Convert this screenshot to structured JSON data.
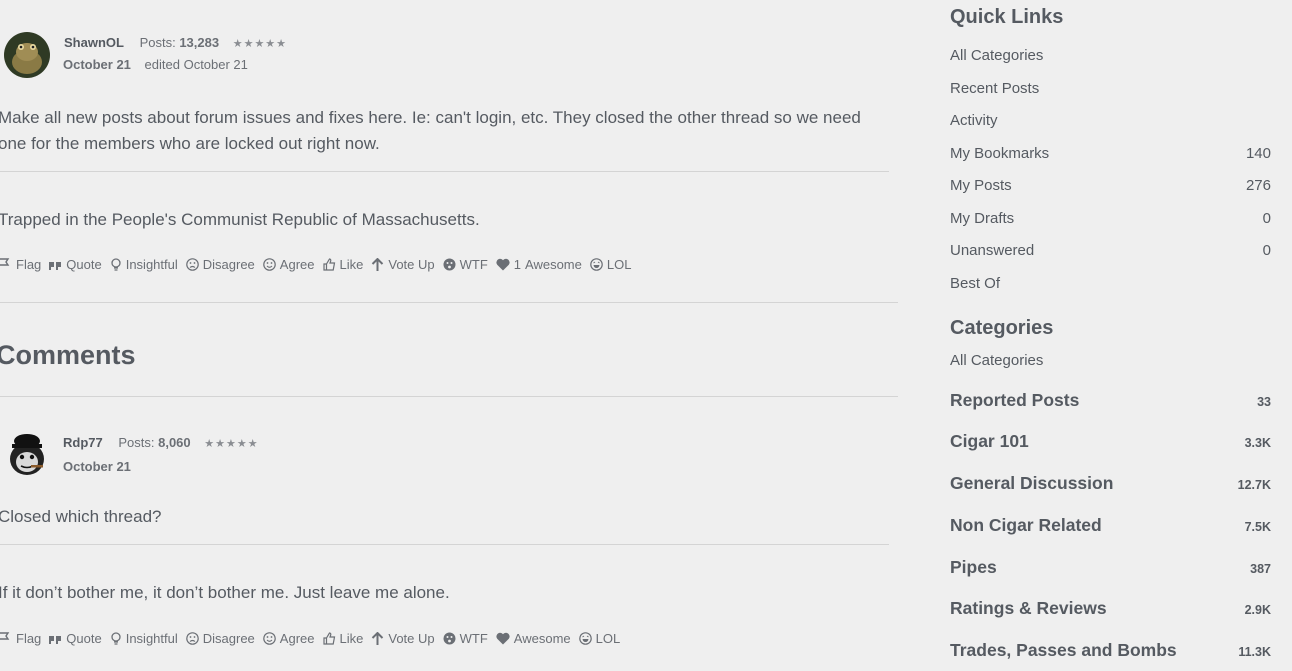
{
  "post": {
    "author": "ShawnOL",
    "posts_label": "Posts:",
    "posts_count": "13,283",
    "stars": "★★★★★",
    "date": "October 21",
    "edited": "edited October 21",
    "body": "Make all new posts about forum issues and fixes here. Ie: can't login, etc. They closed the other thread so we need one for the members who are locked out right now.",
    "signature": "Trapped in the People's Communist Republic of Massachusetts.",
    "reactions": {
      "flag": "Flag",
      "quote": "Quote",
      "insightful": "Insightful",
      "disagree": "Disagree",
      "agree": "Agree",
      "like": "Like",
      "vote_up": "Vote Up",
      "wtf": "WTF",
      "awesome_count": "1",
      "awesome": "Awesome",
      "lol": "LOL"
    }
  },
  "comments_title": "Comments",
  "comment": {
    "author": "Rdp77",
    "posts_label": "Posts:",
    "posts_count": "8,060",
    "stars": "★★★★★",
    "date": "October 21",
    "body": "Closed which thread?",
    "signature": "If it don’t bother me, it don’t bother me. Just leave me alone.",
    "reactions": {
      "flag": "Flag",
      "quote": "Quote",
      "insightful": "Insightful",
      "disagree": "Disagree",
      "agree": "Agree",
      "like": "Like",
      "vote_up": "Vote Up",
      "wtf": "WTF",
      "awesome": "Awesome",
      "lol": "LOL"
    }
  },
  "sidebar": {
    "quick_links_title": "Quick Links",
    "quick_links": [
      {
        "label": "All Categories",
        "count": ""
      },
      {
        "label": "Recent Posts",
        "count": ""
      },
      {
        "label": "Activity",
        "count": ""
      },
      {
        "label": "My Bookmarks",
        "count": "140"
      },
      {
        "label": "My Posts",
        "count": "276"
      },
      {
        "label": "My Drafts",
        "count": "0"
      },
      {
        "label": "Unanswered",
        "count": "0"
      },
      {
        "label": "Best Of",
        "count": ""
      }
    ],
    "categories_title": "Categories",
    "all_categories": "All Categories",
    "categories": [
      {
        "label": "Reported Posts",
        "count": "33"
      },
      {
        "label": "Cigar 101",
        "count": "3.3K"
      },
      {
        "label": "General Discussion",
        "count": "12.7K"
      },
      {
        "label": "Non Cigar Related",
        "count": "7.5K"
      },
      {
        "label": "Pipes",
        "count": "387"
      },
      {
        "label": "Ratings & Reviews",
        "count": "2.9K"
      },
      {
        "label": "Trades, Passes and Bombs",
        "count": "11.3K"
      }
    ]
  }
}
